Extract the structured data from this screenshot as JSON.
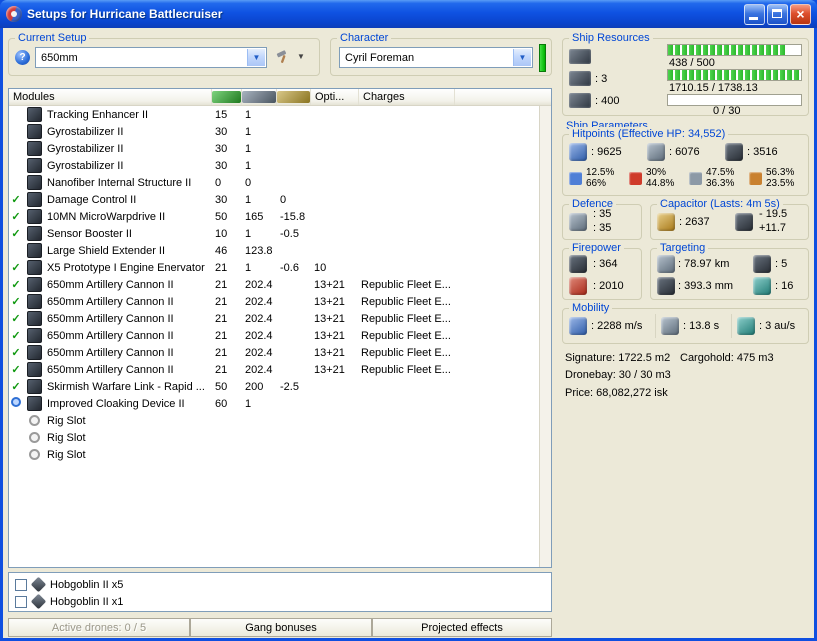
{
  "colors": {
    "titlebar_blue": "#0f4fe0",
    "groupbox_label_blue": "#0046d5",
    "progress_green": "#2db82d",
    "check_green": "#119911",
    "status_green": "#00b400",
    "close_red": "#dd4f2e"
  },
  "window": {
    "title": "Setups for Hurricane Battlecruiser"
  },
  "setup": {
    "label": "Current Setup",
    "value": "650mm"
  },
  "character": {
    "label": "Character",
    "value": "Cyril Foreman"
  },
  "resources": {
    "label": "Ship Resources",
    "launchers": ": 3",
    "calibration": ": 400",
    "cpu": {
      "text": "438 / 500",
      "pct": 87.6
    },
    "powergrid": {
      "text": "1710.15 / 1738.13",
      "pct": 98.4
    },
    "upgrades": {
      "text": "0 / 30",
      "pct": 0
    }
  },
  "modules_table": {
    "header": {
      "modules": "Modules",
      "opti": "Opti...",
      "charges": "Charges"
    },
    "rows": [
      {
        "state": "none",
        "icon": "tracking-enhancer-icon",
        "name": "Tracking Enhancer II",
        "cpu": "15",
        "pg": "1",
        "cap": "",
        "opti": "",
        "charge": ""
      },
      {
        "state": "none",
        "icon": "gyrostabilizer-icon",
        "name": "Gyrostabilizer II",
        "cpu": "30",
        "pg": "1",
        "cap": "",
        "opti": "",
        "charge": ""
      },
      {
        "state": "none",
        "icon": "gyrostabilizer-icon",
        "name": "Gyrostabilizer II",
        "cpu": "30",
        "pg": "1",
        "cap": "",
        "opti": "",
        "charge": ""
      },
      {
        "state": "none",
        "icon": "gyrostabilizer-icon",
        "name": "Gyrostabilizer II",
        "cpu": "30",
        "pg": "1",
        "cap": "",
        "opti": "",
        "charge": ""
      },
      {
        "state": "none",
        "icon": "nanofiber-structure-icon",
        "name": "Nanofiber Internal Structure II",
        "cpu": "0",
        "pg": "0",
        "cap": "",
        "opti": "",
        "charge": ""
      },
      {
        "state": "active",
        "icon": "damage-control-icon",
        "name": "Damage Control II",
        "cpu": "30",
        "pg": "1",
        "cap": "0",
        "opti": "",
        "charge": ""
      },
      {
        "state": "active",
        "icon": "microwarpdrive-icon",
        "name": "10MN MicroWarpdrive II",
        "cpu": "50",
        "pg": "165",
        "cap": "-15.8",
        "opti": "",
        "charge": ""
      },
      {
        "state": "active",
        "icon": "sensor-booster-icon",
        "name": "Sensor Booster II",
        "cpu": "10",
        "pg": "1",
        "cap": "-0.5",
        "opti": "",
        "charge": ""
      },
      {
        "state": "none",
        "icon": "shield-extender-icon",
        "name": "Large Shield Extender II",
        "cpu": "46",
        "pg": "123.8",
        "cap": "",
        "opti": "",
        "charge": ""
      },
      {
        "state": "active",
        "icon": "stasis-webifier-icon",
        "name": "X5 Prototype I Engine Enervator",
        "cpu": "21",
        "pg": "1",
        "cap": "-0.6",
        "opti": "10",
        "charge": ""
      },
      {
        "state": "active",
        "icon": "artillery-cannon-icon",
        "name": "650mm Artillery Cannon II",
        "cpu": "21",
        "pg": "202.4",
        "cap": "",
        "opti": "13+21",
        "charge": "Republic Fleet E..."
      },
      {
        "state": "active",
        "icon": "artillery-cannon-icon",
        "name": "650mm Artillery Cannon II",
        "cpu": "21",
        "pg": "202.4",
        "cap": "",
        "opti": "13+21",
        "charge": "Republic Fleet E..."
      },
      {
        "state": "active",
        "icon": "artillery-cannon-icon",
        "name": "650mm Artillery Cannon II",
        "cpu": "21",
        "pg": "202.4",
        "cap": "",
        "opti": "13+21",
        "charge": "Republic Fleet E..."
      },
      {
        "state": "active",
        "icon": "artillery-cannon-icon",
        "name": "650mm Artillery Cannon II",
        "cpu": "21",
        "pg": "202.4",
        "cap": "",
        "opti": "13+21",
        "charge": "Republic Fleet E..."
      },
      {
        "state": "active",
        "icon": "artillery-cannon-icon",
        "name": "650mm Artillery Cannon II",
        "cpu": "21",
        "pg": "202.4",
        "cap": "",
        "opti": "13+21",
        "charge": "Republic Fleet E..."
      },
      {
        "state": "active",
        "icon": "artillery-cannon-icon",
        "name": "650mm Artillery Cannon II",
        "cpu": "21",
        "pg": "202.4",
        "cap": "",
        "opti": "13+21",
        "charge": "Republic Fleet E..."
      },
      {
        "state": "active",
        "icon": "warfare-link-icon",
        "name": "Skirmish Warfare Link - Rapid ...",
        "cpu": "50",
        "pg": "200",
        "cap": "-2.5",
        "opti": "",
        "charge": ""
      },
      {
        "state": "inactive",
        "icon": "cloaking-device-icon",
        "name": "Improved Cloaking Device II",
        "cpu": "60",
        "pg": "1",
        "cap": "",
        "opti": "",
        "charge": ""
      },
      {
        "state": "rig",
        "icon": "rig-slot-icon",
        "name": "Rig Slot",
        "cpu": "",
        "pg": "",
        "cap": "",
        "opti": "",
        "charge": ""
      },
      {
        "state": "rig",
        "icon": "rig-slot-icon",
        "name": "Rig Slot",
        "cpu": "",
        "pg": "",
        "cap": "",
        "opti": "",
        "charge": ""
      },
      {
        "state": "rig",
        "icon": "rig-slot-icon",
        "name": "Rig Slot",
        "cpu": "",
        "pg": "",
        "cap": "",
        "opti": "",
        "charge": ""
      }
    ]
  },
  "drones": {
    "rows": [
      {
        "label": "Hobgoblin II x5"
      },
      {
        "label": "Hobgoblin II x1"
      }
    ]
  },
  "footer": {
    "active_drones": "Active drones: 0 / 5",
    "gang_bonuses": "Gang bonuses",
    "projected_effects": "Projected effects"
  },
  "parameters": {
    "label": "Ship Parameters",
    "hitpoints": {
      "label": "Hitpoints (Effective HP: 34,552)",
      "shield": ": 9625",
      "armor": ": 6076",
      "hull": ": 3516",
      "resists": [
        {
          "icon": "em-resist-icon",
          "color": "#4f7fd6",
          "shield": "12.5%",
          "armor": "66%"
        },
        {
          "icon": "thermal-resist-icon",
          "color": "#cf3b2a",
          "shield": "30%",
          "armor": "44.8%"
        },
        {
          "icon": "kinetic-resist-icon",
          "color": "#8c99a6",
          "shield": "47.5%",
          "armor": "36.3%"
        },
        {
          "icon": "explosive-resist-icon",
          "color": "#c9812f",
          "shield": "56.3%",
          "armor": "23.5%"
        }
      ]
    },
    "defence": {
      "label": "Defence",
      "value1": ": 35",
      "value2": ": 35"
    },
    "capacitor": {
      "label": "Capacitor (Lasts: 4m 5s)",
      "amount": ": 2637",
      "drain": "- 19.5",
      "recharge": "+11.7"
    },
    "firepower": {
      "label": "Firepower",
      "dps": ": 364",
      "volley": ": 2010"
    },
    "targeting": {
      "label": "Targeting",
      "range": ": 78.97 km",
      "max_targets": ": 5",
      "scan_resolution": ": 393.3 mm",
      "sensor_strength": ": 16"
    },
    "mobility": {
      "label": "Mobility",
      "speed": ": 2288 m/s",
      "align_time": ": 13.8 s",
      "warp_speed": ": 3 au/s"
    },
    "stats": {
      "signature": "Signature: 1722.5 m2",
      "cargohold": "Cargohold: 475 m3",
      "dronebay": "Dronebay: 30 / 30 m3",
      "price": "Price: 68,082,272 isk"
    }
  }
}
